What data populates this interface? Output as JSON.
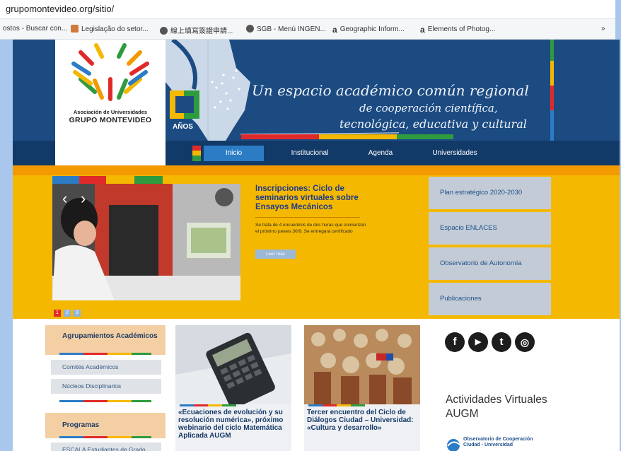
{
  "browser": {
    "url": "grupomontevideo.org/sitio/",
    "bookmarks": [
      {
        "label": "ostos - Buscar con...",
        "icon": "none"
      },
      {
        "label": "Legislação do setor...",
        "icon": "calendar-icon"
      },
      {
        "label": "線上填寫簽證申請...",
        "icon": "globe-icon"
      },
      {
        "label": "SGB - Menú INGEN...",
        "icon": "globe-icon"
      },
      {
        "label": "Geographic Inform...",
        "icon": "amazon-icon"
      },
      {
        "label": "Elements of Photog...",
        "icon": "amazon-icon"
      }
    ],
    "more": "»"
  },
  "header": {
    "logo_line1": "Asociación de Universidades",
    "logo_line2": "GRUPO MONTEVIDEO",
    "anniversary": "AÑOS",
    "slogan_line1": "Un espacio académico común regional",
    "slogan_line2": "de cooperación científica,",
    "slogan_line3": "tecnológica, educativa y cultural"
  },
  "nav": {
    "items": [
      "Inicio",
      "Institucional",
      "Agenda",
      "Universidades"
    ]
  },
  "slider": {
    "title": "Inscripciones: Ciclo de seminarios virtuales sobre Ensayos Mecánicos",
    "body": "Se trata de 4 encuentros de dos horas que comienzan el próximo jueves 30/9. Se entregará certificado",
    "read_more": "Leer más",
    "pages": [
      "1",
      "2",
      "3"
    ]
  },
  "side_links": [
    "Plan estratégico 2020-2030",
    "Espacio ENLACES",
    "Observatorio de Autonomía",
    "Publicaciones"
  ],
  "left": {
    "group1_title": "Agrupamientos Académicos",
    "group1_items": [
      "Comités Académicos",
      "Núcleos Disciplinarios"
    ],
    "group2_title": "Programas",
    "group2_items": [
      "ESCALA Estudiantes de Grado"
    ]
  },
  "cards": [
    {
      "title": "«Ecuaciones de evolución y su resolución numérica», próximo webinario del ciclo Matemática Aplicada AUGM"
    },
    {
      "title": "Tercer encuentro del Ciclo de Diálogos Ciudad – Universidad: «Cultura y desarrollo»"
    }
  ],
  "social": {
    "facebook": "f",
    "youtube": "▶",
    "twitter": "t",
    "instagram": "◎"
  },
  "activities": {
    "title": "Actividades Virtuales AUGM",
    "observatory_line1": "Observatorio de Cooperación",
    "observatory_line2": "Ciudad - Universidad"
  },
  "colors": {
    "blue": "#1c4b82",
    "yellow": "#f5b800",
    "red": "#e02a2a",
    "green": "#2e9b3e",
    "orange": "#f29a00"
  }
}
